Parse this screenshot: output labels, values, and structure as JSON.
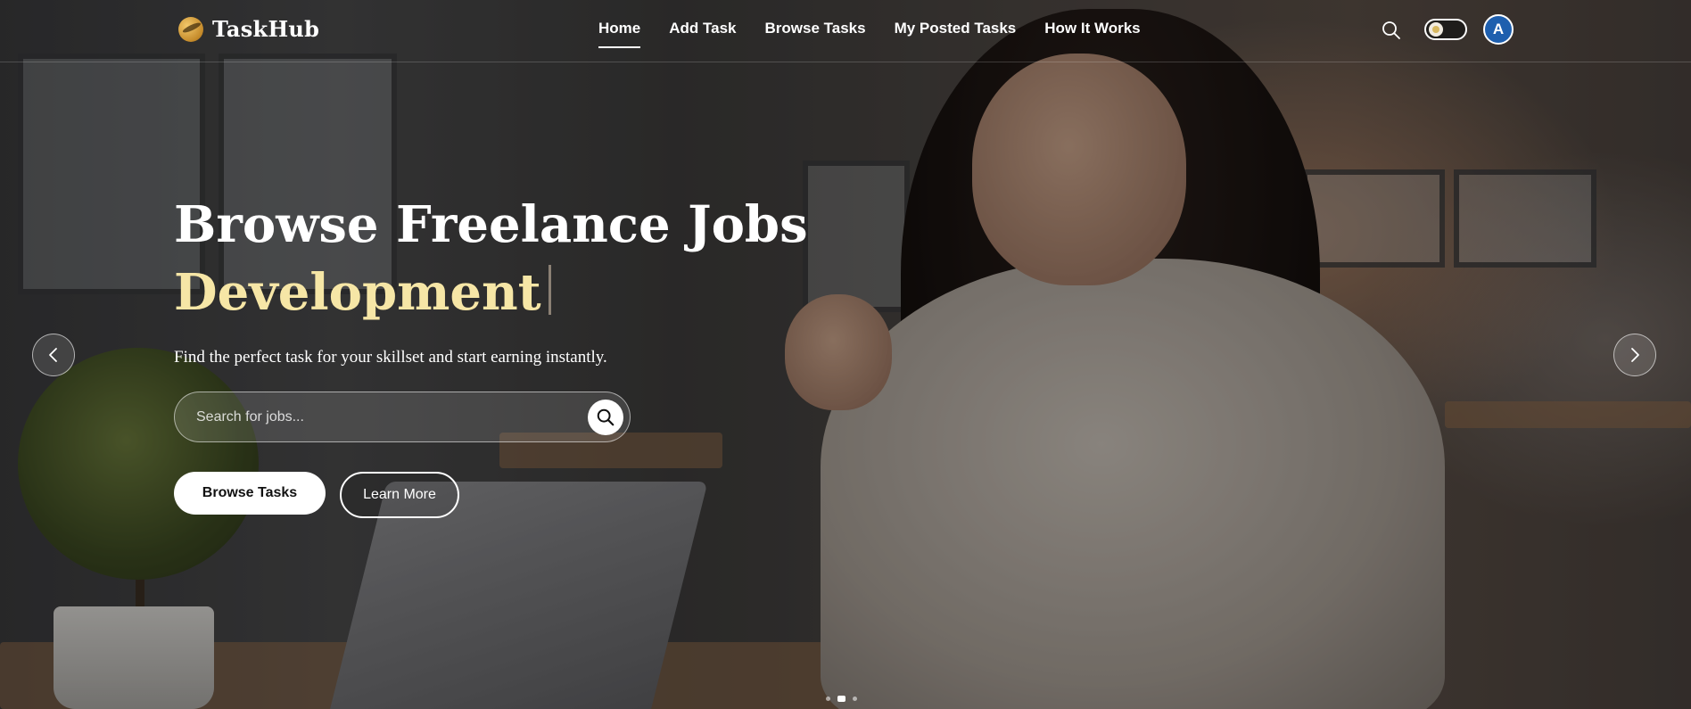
{
  "brand": {
    "name": "TaskHub"
  },
  "nav": {
    "items": [
      {
        "label": "Home",
        "active": true
      },
      {
        "label": "Add Task",
        "active": false
      },
      {
        "label": "Browse Tasks",
        "active": false
      },
      {
        "label": "My Posted Tasks",
        "active": false
      },
      {
        "label": "How It Works",
        "active": false
      }
    ]
  },
  "header": {
    "search_icon": "search-icon",
    "theme_toggle_icon": "sun-icon",
    "avatar_initial": "A"
  },
  "hero": {
    "title_line1": "Browse Freelance Jobs",
    "title_line2": "Development",
    "subtitle": "Find the perfect task for your skillset and start earning instantly.",
    "search_placeholder": "Search for jobs...",
    "primary_button": "Browse Tasks",
    "secondary_button": "Learn More"
  },
  "carousel": {
    "slide_count": 3,
    "active_slide": 2,
    "prev_icon": "chevron-left-icon",
    "next_icon": "chevron-right-icon"
  },
  "colors": {
    "highlight": "#f6e6a6",
    "avatar_bg": "#1e5fae",
    "logo_gold": "#c48a2a"
  }
}
